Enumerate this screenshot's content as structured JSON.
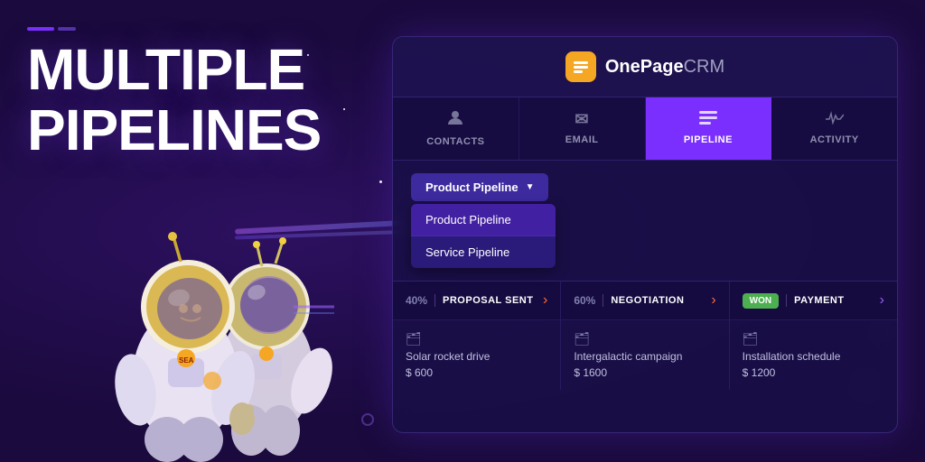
{
  "background": {
    "color": "#1a0a3d"
  },
  "title": {
    "accent_line": "——",
    "line1": "MULTIPLE",
    "line2": "PIPELINES"
  },
  "crm": {
    "logo": {
      "text_one": "OnePage",
      "text_two": "CRM"
    },
    "nav": {
      "tabs": [
        {
          "id": "contacts",
          "label": "CONTACTS",
          "icon": "👤",
          "active": false
        },
        {
          "id": "email",
          "label": "EMAIL",
          "icon": "✉",
          "active": false
        },
        {
          "id": "pipeline",
          "label": "PIPELINE",
          "icon": "≡",
          "active": true
        },
        {
          "id": "activity",
          "label": "ACTIVITY",
          "icon": "📈",
          "active": false
        }
      ]
    },
    "dropdown": {
      "selected": "Product Pipeline",
      "arrow": "▼",
      "options": [
        {
          "label": "Product Pipeline",
          "selected": true
        },
        {
          "label": "Service Pipeline",
          "selected": false
        }
      ]
    },
    "stages": [
      {
        "id": "proposal",
        "pct": "40%",
        "name": "PROPOSAL SENT",
        "arrow": "›",
        "won": false,
        "deal": {
          "icon": "🗂",
          "name": "Solar rocket drive",
          "amount": "$ 600"
        }
      },
      {
        "id": "negotiation",
        "pct": "60%",
        "name": "NEGOTIATION",
        "arrow": "›",
        "won": false,
        "deal": {
          "icon": "🗂",
          "name": "Intergalactic campaign",
          "amount": "$ 1600"
        }
      },
      {
        "id": "payment",
        "pct": "",
        "name": "PAYMENT",
        "arrow": "›",
        "won": true,
        "deal": {
          "icon": "🗂",
          "name": "Installation schedule",
          "amount": "$ 1200"
        }
      }
    ]
  }
}
